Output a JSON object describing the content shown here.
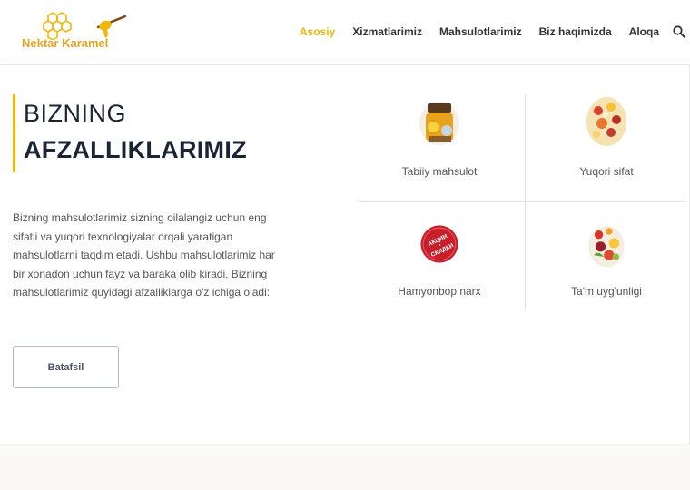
{
  "logo": {
    "text": "Nektar Karamel"
  },
  "nav": {
    "items": [
      {
        "label": "Asosiy"
      },
      {
        "label": "Xizmatlarimiz"
      },
      {
        "label": "Mahsulotlarimiz"
      },
      {
        "label": "Biz haqimizda"
      },
      {
        "label": "Aloqa"
      }
    ],
    "search_icon": "search-icon"
  },
  "section": {
    "title_line1": "BIZNING",
    "title_line2": "AFZALLIKLARIMIZ",
    "description": "Bizning mahsulotlarimiz sizning oilalangiz uchun eng sifatli va yuqori texnologiyalar orqali yaratigan mahsulotlarni taqdim etadi. Ushbu mahsulotlarimiz har bir xonadon uchun fayz va baraka olib kiradi. Bizning mahsulotlarimiz quyidagi afzalliklarga o'z ichiga oladi:",
    "button_label": "Batafsil"
  },
  "features": [
    {
      "label": "Tabiiy mahsulot",
      "icon": "honey-jar-image"
    },
    {
      "label": "Yuqori sifat",
      "icon": "candy-image"
    },
    {
      "label": "Hamyonbop narx",
      "icon": "sale-badge-image",
      "badge_text": "АКЦИИ • СКИДКИ"
    },
    {
      "label": "Ta'm uyg'unligi",
      "icon": "fruit-image"
    }
  ],
  "colors": {
    "accent": "#f2b705",
    "heading": "#1a2433"
  }
}
